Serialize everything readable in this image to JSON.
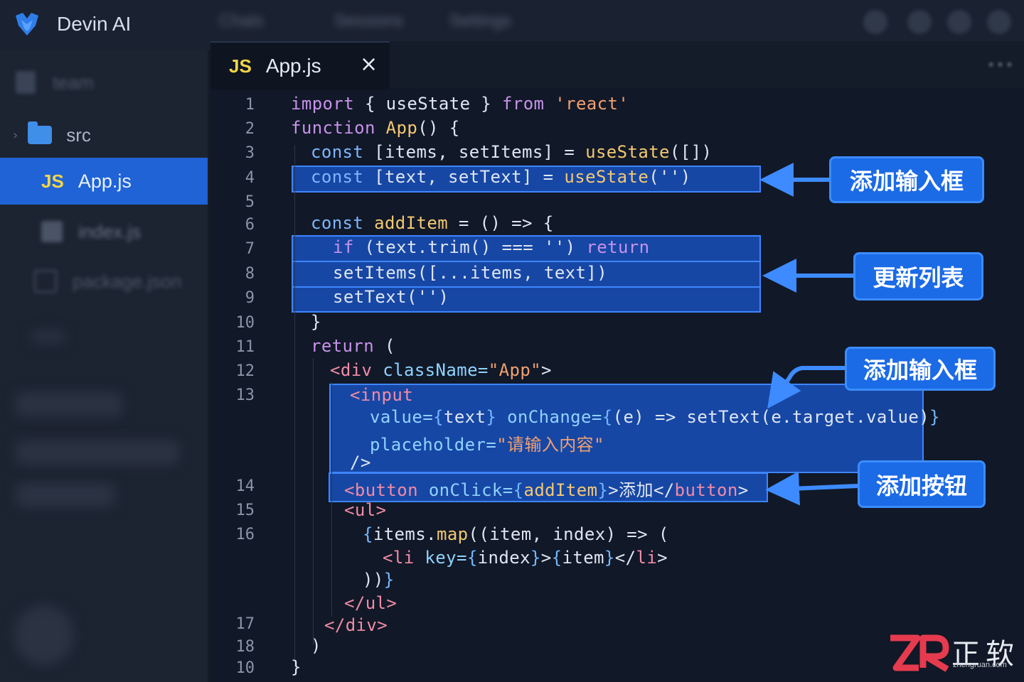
{
  "app": {
    "title": "Devin AI"
  },
  "topbar": {
    "menu_items": [
      "Chats",
      "Sessions",
      "Settings"
    ]
  },
  "sidebar": {
    "items": [
      {
        "label": "team",
        "icon": "file-icon",
        "blurred": true
      },
      {
        "label": "src",
        "icon": "folder-icon"
      },
      {
        "label": "App.js",
        "icon": "js-icon",
        "badge": "JS",
        "active": true
      },
      {
        "label": "index.js",
        "icon": "image-file-icon",
        "blurred": true
      },
      {
        "label": "package.json",
        "icon": "package-icon",
        "blurred": true
      }
    ]
  },
  "editor": {
    "tab": {
      "badge": "JS",
      "name": "App.js",
      "close": "×"
    },
    "line_numbers": [
      "1",
      "2",
      "3",
      "4",
      "5",
      "6",
      "7",
      "8",
      "9",
      "10",
      "11",
      "12",
      "13",
      "14",
      "15",
      "16",
      "17",
      "18",
      "10"
    ]
  },
  "callouts": {
    "c1": "添加输入框",
    "c2": "更新列表",
    "c3": "添加输入框",
    "c4": "添加按钮"
  },
  "colors": {
    "accent": "#1f63d6",
    "highlight": "#1a5ad7",
    "callout_bg": "#1b6ae6",
    "keyword": "#c792ea",
    "function": "#f3c872",
    "string": "#f0a070",
    "tag": "#f08ba5"
  },
  "watermark": {
    "logo": "ZR",
    "name": "正软",
    "url": "zhengruan.com"
  },
  "code": {
    "l1": {
      "k1": "import",
      "t1": " { useState } ",
      "k2": "from",
      "s1": " 'react'"
    },
    "l2": {
      "k1": "function",
      "f1": " App",
      "t1": "() {"
    },
    "l3": {
      "k1": "const",
      "t1": " [items, setItems] = ",
      "f1": "useState",
      "t2": "([])"
    },
    "l4": {
      "k1": "const",
      "t1": " [text, setText] = ",
      "f1": "useState",
      "t2": "('')"
    },
    "l6": {
      "k1": "const",
      "f1": " addItem",
      "t1": " = () => {"
    },
    "l7": {
      "k1": "if",
      "t1": " (text.trim() === '') ",
      "k2": "return"
    },
    "l8": "setItems([...items, text])",
    "l9": "setText('')",
    "l10": "}",
    "l11": {
      "k1": "return",
      "t1": " ("
    },
    "l12": {
      "t1": "<",
      "tag": "div",
      "a1": " className=",
      "s1": "\"App\"",
      "t2": ">"
    },
    "l13": {
      "t1": "<",
      "tag": "input"
    },
    "l13b": {
      "a1": "value=",
      "b1": "{",
      "t1": "text",
      "b2": "}",
      "a2": " onChange=",
      "b3": "{",
      "t2": "(e) => setText(e.target.value)",
      "b4": "}"
    },
    "l13c": {
      "a1": "placeholder=",
      "s1": "\"请输入内容\""
    },
    "l13d": "/>",
    "l14": {
      "t1": "<",
      "tag": "button",
      "a1": " onClick=",
      "b1": "{",
      "t2": "addItem",
      "b2": "}",
      "t3": ">添加</",
      "tag2": "button",
      "t4": ">"
    },
    "l15": {
      "t1": "<",
      "tag": "ul",
      "t2": ">"
    },
    "l16": {
      "b1": "{",
      "t1": "items.",
      "f1": "map",
      "t2": "((item, index) => ("
    },
    "l16b": {
      "t1": "<",
      "tag": "li",
      "a1": " key=",
      "b1": "{",
      "t2": "index",
      "b2": "}",
      "t3": ">",
      "b3": "{",
      "t4": "item",
      "b4": "}",
      "t5": "</",
      "tag2": "li",
      "t6": ">"
    },
    "l16c": {
      "t1": "))",
      "b1": "}"
    },
    "l16d": {
      "t1": "</",
      "tag": "ul",
      "t2": ">"
    },
    "l17": {
      "t1": "</",
      "tag": "div",
      "t2": ">"
    },
    "l18": ")",
    "l19": "}"
  }
}
